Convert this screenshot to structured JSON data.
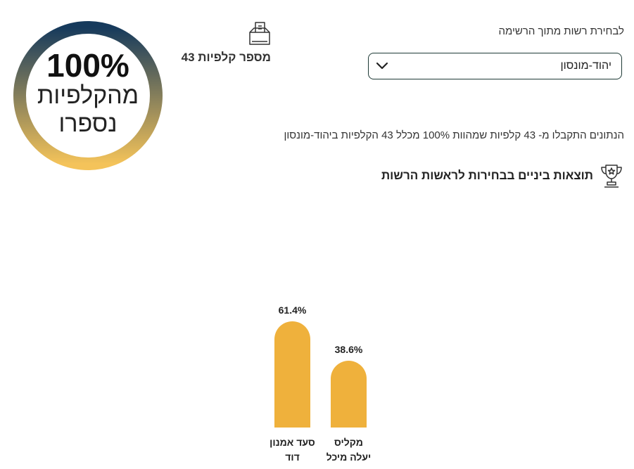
{
  "counted_ring": {
    "percent_label": "100%",
    "line1": "מהקלפיות",
    "line2": "נספרו",
    "colors": {
      "top": "#163a5c",
      "bottom": "#f4c35a"
    }
  },
  "ballot_box": {
    "icon": "ballot-box-icon",
    "count_label": "מספר קלפיות 43"
  },
  "authority_select": {
    "label": "לבחירת רשות מתוך הרשימה",
    "selected_value": "יהוד-מונסון",
    "icon": "chevron-down-icon"
  },
  "status_text": "הנתונים התקבלו מ- 43 קלפיות שמהוות 100% מכלל 43 הקלפיות ביהוד-מונסון",
  "results": {
    "icon": "trophy-icon",
    "title": "תוצאות ביניים בבחירות לראשות הרשות"
  },
  "chart_data": {
    "type": "bar",
    "categories": [
      [
        "סעד אמנון",
        "דוד"
      ],
      [
        "מקליס",
        "יעלה מיכל"
      ]
    ],
    "values": [
      61.4,
      38.6
    ],
    "value_labels": [
      "61.4%",
      "38.6%"
    ],
    "ylim": [
      0,
      100
    ],
    "bar_color": "#efb13c",
    "grid": false,
    "legend": "none"
  }
}
